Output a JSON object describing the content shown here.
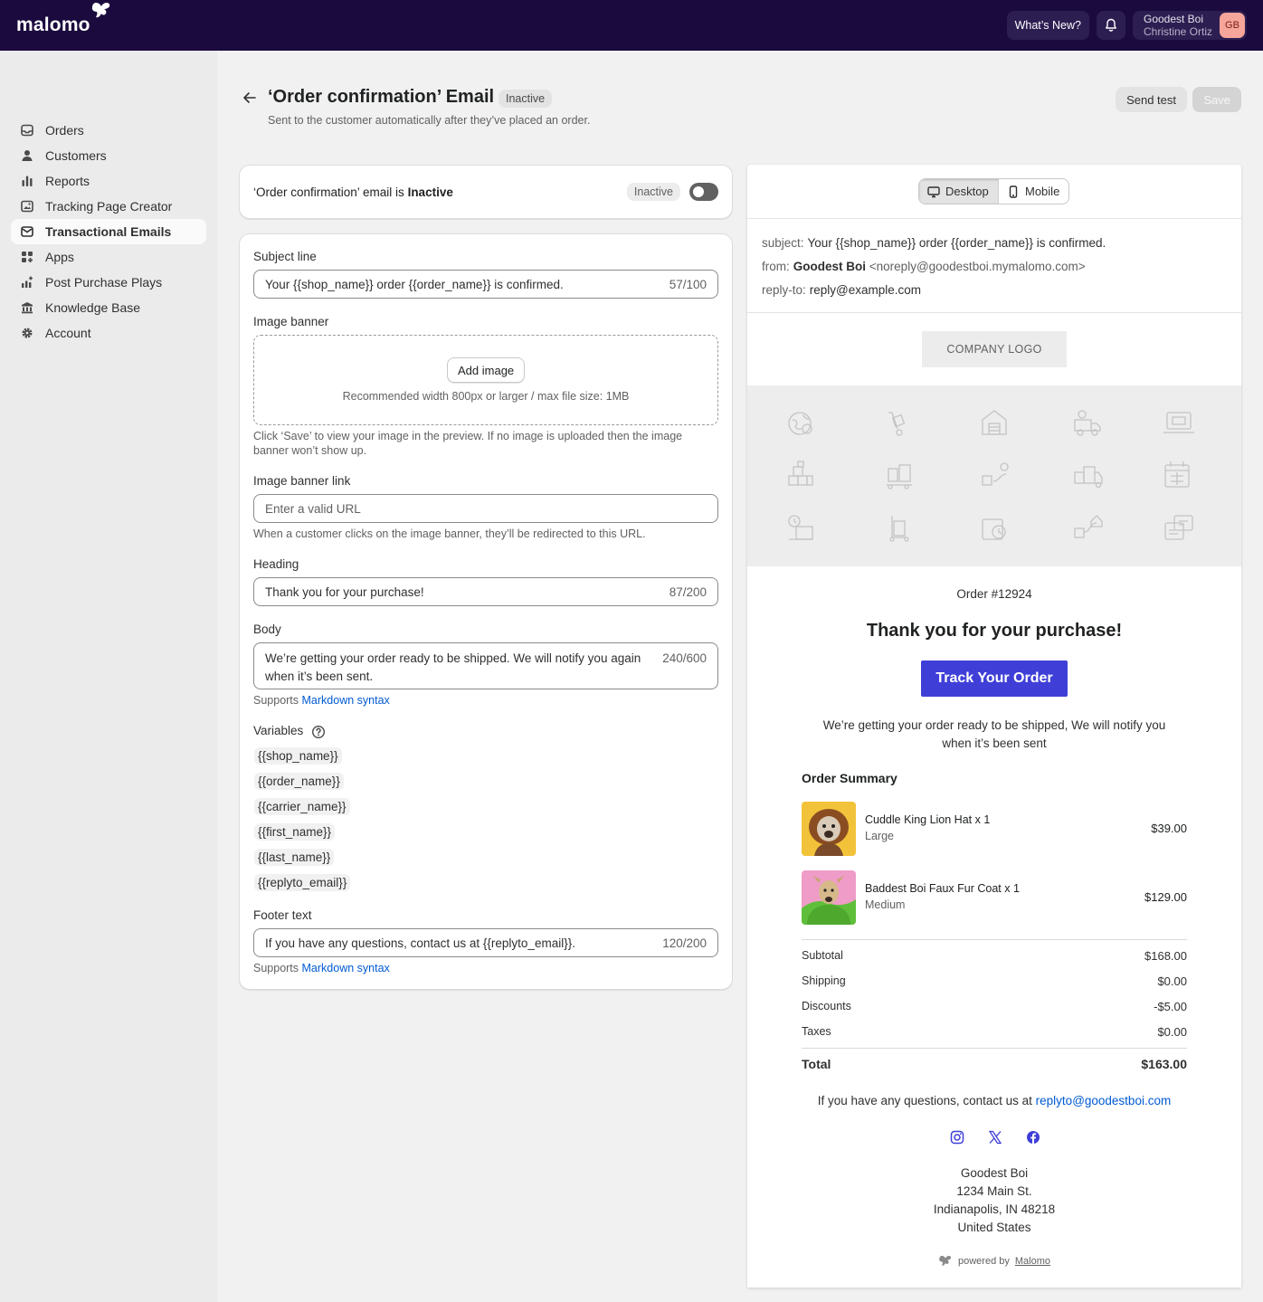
{
  "topbar": {
    "logo_text": "malomo",
    "whats_new": "What’s New?",
    "shop_name": "Goodest Boi",
    "user_name": "Christine Ortiz",
    "avatar_initials": "GB"
  },
  "sidebar": {
    "items": [
      {
        "label": "Orders",
        "icon": "inbox-icon"
      },
      {
        "label": "Customers",
        "icon": "person-icon"
      },
      {
        "label": "Reports",
        "icon": "bar-chart-icon"
      },
      {
        "label": "Tracking Page Creator",
        "icon": "image-icon"
      },
      {
        "label": "Transactional Emails",
        "icon": "email-icon",
        "active": true
      },
      {
        "label": "Apps",
        "icon": "apps-icon"
      },
      {
        "label": "Post Purchase Plays",
        "icon": "chart-plus-icon"
      },
      {
        "label": "Knowledge Base",
        "icon": "bank-icon"
      },
      {
        "label": "Account",
        "icon": "gear-icon"
      }
    ]
  },
  "header": {
    "title": "‘Order confirmation’ Email",
    "status": "Inactive",
    "subtitle": "Sent to the customer automatically after they’ve placed an order.",
    "send_test": "Send test",
    "save": "Save"
  },
  "status_card": {
    "prefix": "‘Order confirmation’ email is ",
    "state": "Inactive",
    "badge": "Inactive",
    "enabled": false
  },
  "form": {
    "subject": {
      "label": "Subject line",
      "value": "Your {{shop_name}} order {{order_name}} is confirmed.",
      "count": "57/100"
    },
    "banner": {
      "label": "Image banner",
      "button": "Add image",
      "recommend": "Recommended width 800px or larger / max file size: 1MB",
      "help": "Click ‘Save’ to view your image in the preview. If no image is uploaded then the image banner won’t show up."
    },
    "banner_link": {
      "label": "Image banner link",
      "placeholder": "Enter a valid URL",
      "help": "When a customer clicks on the image banner, they’ll be redirected to this URL."
    },
    "heading": {
      "label": "Heading",
      "value": "Thank you for your purchase!",
      "count": "87/200"
    },
    "body": {
      "label": "Body",
      "value": "We’re getting your order ready to be shipped. We will notify you again when it’s been sent.",
      "count": "240/600",
      "help_prefix": "Supports ",
      "help_link": "Markdown syntax"
    },
    "variables": {
      "label": "Variables",
      "items": [
        "{{shop_name}}",
        "{{order_name}}",
        "{{carrier_name}}",
        "{{first_name}}",
        "{{last_name}}",
        "{{replyto_email}}"
      ]
    },
    "footer": {
      "label": "Footer text",
      "value": "If you have any questions, contact us at {{replyto_email}}.",
      "count": "120/200",
      "help_prefix": "Supports ",
      "help_link": "Markdown syntax"
    }
  },
  "preview": {
    "tabs": [
      "Desktop",
      "Mobile"
    ],
    "subject_key": "subject:",
    "subject": "Your {{shop_name}} order {{order_name}} is confirmed.",
    "from_key": "from:",
    "from_name": "Goodest Boi",
    "from_email": "<noreply@goodestboi.mymalomo.com>",
    "reply_key": "reply-to:",
    "reply_to": "reply@example.com",
    "company_logo": "COMPANY LOGO",
    "order_number": "Order #12924",
    "heading": "Thank you for your purchase!",
    "track_button": "Track Your Order",
    "body": "We’re getting your order ready to be shipped, We will notify you when it’s been sent",
    "summary_title": "Order Summary",
    "items": [
      {
        "name": "Cuddle King Lion Hat x 1",
        "variant": "Large",
        "price": "$39.00"
      },
      {
        "name": "Baddest Boi Faux Fur Coat x 1",
        "variant": "Medium",
        "price": "$129.00"
      }
    ],
    "totals": [
      {
        "label": "Subtotal",
        "value": "$168.00"
      },
      {
        "label": "Shipping",
        "value": "$0.00"
      },
      {
        "label": "Discounts",
        "value": "-$5.00"
      },
      {
        "label": "Taxes",
        "value": "$0.00"
      }
    ],
    "total": {
      "label": "Total",
      "value": "$163.00"
    },
    "contact_prefix": "If you have any questions, contact us at ",
    "contact_email": "replyto@goodestboi.com",
    "address": [
      "Goodest Boi",
      "1234 Main St.",
      "Indianapolis, IN 48218",
      "United States"
    ],
    "powered_prefix": "powered by",
    "powered_brand": "Malomo"
  },
  "colors": {
    "topbar": "#1b0a3e",
    "primary": "#3f3fd8",
    "link": "#005bd3"
  }
}
